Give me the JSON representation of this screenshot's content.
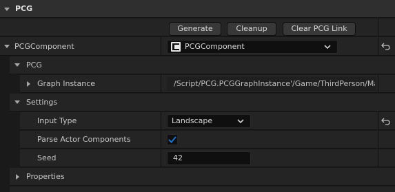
{
  "header": {
    "title": "PCG"
  },
  "actions": {
    "generate": "Generate",
    "cleanup": "Cleanup",
    "clear_link": "Clear PCG Link"
  },
  "component": {
    "label": "PCGComponent",
    "value": "PCGComponent"
  },
  "pcg_section": {
    "title": "PCG",
    "graph_instance_label": "Graph Instance",
    "graph_instance_value": "/Script/PCG.PCGGraphInstance'/Game/ThirdPerson/Ma"
  },
  "settings": {
    "title": "Settings",
    "input_type_label": "Input Type",
    "input_type_value": "Landscape",
    "parse_actor_label": "Parse Actor Components",
    "parse_actor_checked": true,
    "seed_label": "Seed",
    "seed_value": "42"
  },
  "properties": {
    "title": "Properties"
  },
  "colors": {
    "accent": "#1e74d0",
    "panel": "#242424",
    "field": "#0f0f0f"
  },
  "icons": {
    "reset": "reset-arrow-icon",
    "collapse": "triangle-down-icon",
    "expand": "triangle-right-icon",
    "class": "component-class-icon"
  }
}
